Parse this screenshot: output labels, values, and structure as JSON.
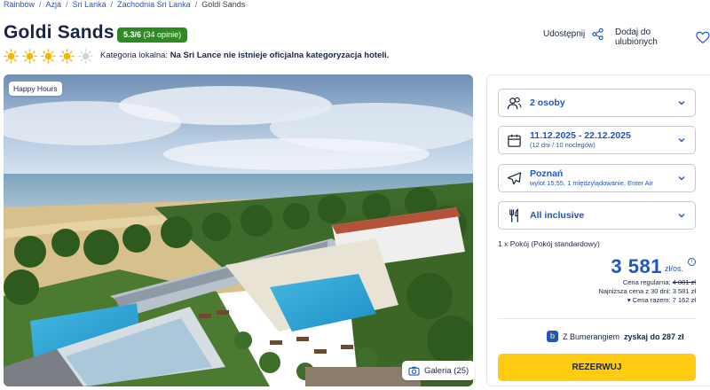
{
  "breadcrumb": {
    "items": [
      "Rainbow",
      "Azja",
      "Sri Lanka",
      "Zachodnia Sri Lanka"
    ],
    "current": "Goldi Sands"
  },
  "hotel": {
    "name": "Goldi Sands",
    "rating": "5.3/6",
    "rating_count": "(34 opinie)",
    "sun_rating": 4,
    "sun_max": 5,
    "local_category_label": "Kategoria lokalna:",
    "local_category_value": "Na Sri Lance nie istnieje oficjalna kategoryzacja hoteli."
  },
  "actions": {
    "share_label": "Udostępnij",
    "favorite_label": "Dodaj do ulubionych"
  },
  "gallery": {
    "badge": "Happy Hours",
    "button_label": "Galeria (25)"
  },
  "booking": {
    "guests": "2 osoby",
    "dates": "11.12.2025 - 22.12.2025",
    "dates_sub": "(12 dni / 10 noclegów)",
    "departure": "Poznań",
    "departure_sub": "wylot 15:55, 1 międzylądowanie, Enter Air",
    "board": "All inclusive",
    "room": "1 x Pokój  (Pokój standardowy)",
    "price": "3 581",
    "price_unit": "zł/os.",
    "regular_label": "Cena regularna:",
    "regular_value": "4 081 zł",
    "lowest_label": "Najniższa cena z 30 dni:",
    "lowest_value": "3 581 zł",
    "total_label": "Cena razem:",
    "total_value": "7 162 zł",
    "boomerang_prefix": "Z Bumerangiem",
    "boomerang_bold": "zyskaj do 287 zł",
    "reserve_label": "REZERWUJ"
  },
  "colors": {
    "brand_blue": "#1e56c8",
    "rating_green": "#2f8a24",
    "reserve_yellow": "#ffcc12",
    "sun_active": "#f5b50a",
    "sun_inactive": "#d1d5db"
  },
  "icons": {
    "share": "share-icon",
    "favorite": "heart-icon",
    "guests": "users-icon",
    "dates": "calendar-icon",
    "departure": "plane-icon",
    "board": "fork-knife-icon",
    "gallery": "camera-icon",
    "chevron": "chevron-down-icon"
  }
}
